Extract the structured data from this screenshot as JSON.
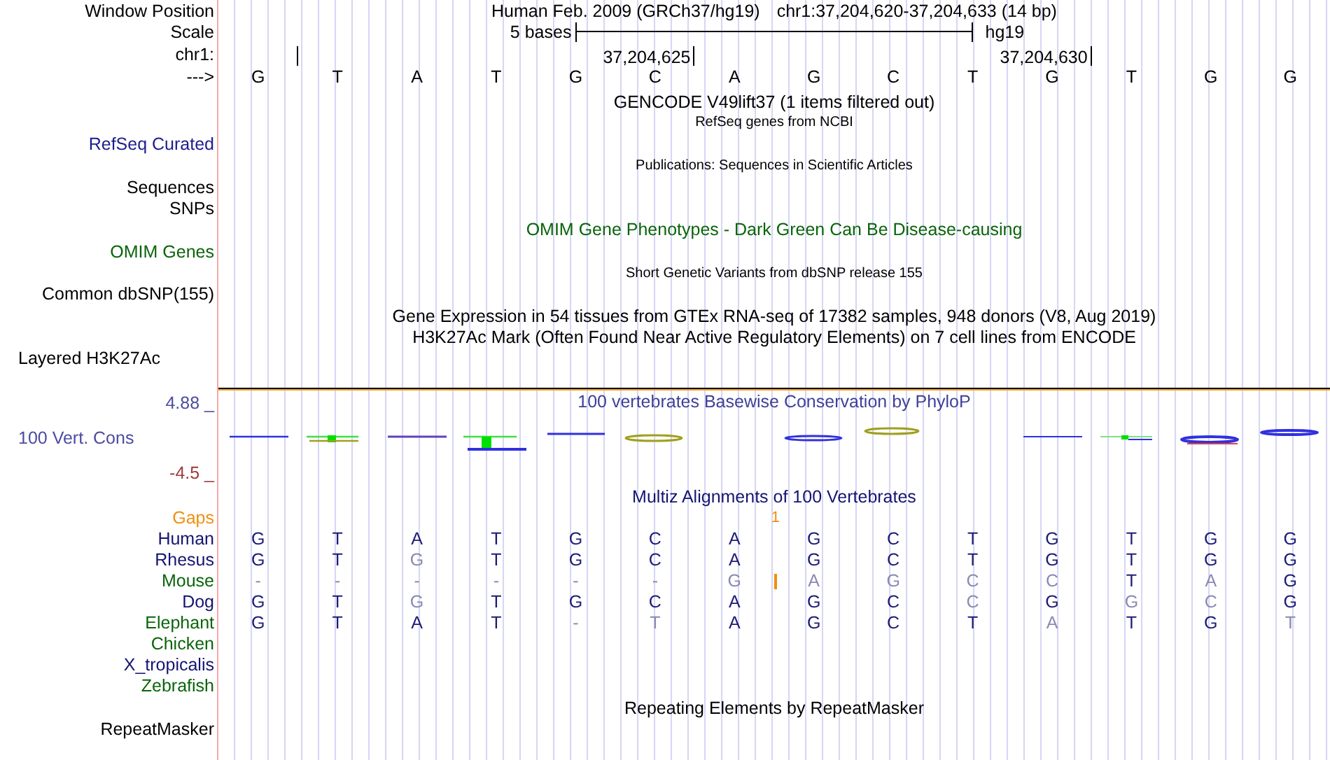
{
  "position_row": {
    "label": "Window Position",
    "assembly": "Human Feb. 2009 (GRCh37/hg19)",
    "range": "chr1:37,204,620-37,204,633 (14 bp)"
  },
  "scale_row": {
    "label": "Scale",
    "span": "5 bases",
    "tag": "hg19"
  },
  "ruler_row": {
    "label": "chr1:",
    "ticks": [
      {
        "kind": "plain"
      },
      {
        "kind": "labeled",
        "text": "37,204,625"
      },
      {
        "kind": "labeled",
        "text": "37,204,630"
      }
    ]
  },
  "sequence_row": {
    "label": "--->",
    "bases": [
      "G",
      "T",
      "A",
      "T",
      "G",
      "C",
      "A",
      "G",
      "C",
      "T",
      "G",
      "T",
      "G",
      "G"
    ]
  },
  "track_lines": [
    {
      "kind": "title",
      "text": "GENCODE V49lift37 (1 items filtered out)",
      "color": "#000000"
    },
    {
      "kind": "note",
      "text": "RefSeq genes from NCBI",
      "color": "#000000"
    },
    {
      "kind": "label",
      "text": "RefSeq Curated",
      "color": "#1c1c90"
    },
    {
      "kind": "note",
      "text": "Publications: Sequences in Scientific Articles",
      "color": "#000000"
    },
    {
      "kind": "label",
      "text": "Sequences",
      "color": "#000000"
    },
    {
      "kind": "label",
      "text": "SNPs",
      "color": "#000000"
    },
    {
      "kind": "title",
      "text": "OMIM Gene Phenotypes - Dark Green Can Be Disease-causing",
      "color": "#0a640a"
    },
    {
      "kind": "label",
      "text": "OMIM Genes",
      "color": "#0a640a"
    },
    {
      "kind": "note",
      "text": "Short Genetic Variants from dbSNP release 155",
      "color": "#000000"
    },
    {
      "kind": "label",
      "text": "Common dbSNP(155)",
      "color": "#000000"
    },
    {
      "kind": "title",
      "text": "Gene Expression in 54 tissues from GTEx RNA-seq of 17382 samples, 948 donors (V8, Aug 2019)",
      "color": "#000000"
    },
    {
      "kind": "title",
      "text": "H3K27Ac Mark (Often Found Near Active Regulatory Elements) on 7 cell lines from ENCODE",
      "color": "#000000"
    },
    {
      "kind": "side_label",
      "text": "Layered H3K27Ac",
      "color": "#000000"
    }
  ],
  "conservation": {
    "title": "100 vertebrates Basewise Conservation by PhyloP",
    "label": "100 Vert. Cons",
    "max": "4.88 _",
    "min": "-4.5 _"
  },
  "multiz": {
    "title": "Multiz Alignments of 100 Vertebrates",
    "gaps_label": "Gaps",
    "species": [
      {
        "name": "Human",
        "color": "#141470",
        "bases": [
          {
            "text": "G",
            "match": true
          },
          {
            "text": "T",
            "match": true
          },
          {
            "text": "A",
            "match": true
          },
          {
            "text": "T",
            "match": true
          },
          {
            "text": "G",
            "match": true
          },
          {
            "text": "C",
            "match": true
          },
          {
            "text": "A",
            "match": true
          },
          {
            "text": "G",
            "match": true
          },
          {
            "text": "C",
            "match": true
          },
          {
            "text": "T",
            "match": true
          },
          {
            "text": "G",
            "match": true
          },
          {
            "text": "T",
            "match": true
          },
          {
            "text": "G",
            "match": true
          },
          {
            "text": "G",
            "match": true
          }
        ]
      },
      {
        "name": "Rhesus",
        "color": "#141470",
        "bases": [
          {
            "text": "G",
            "match": true
          },
          {
            "text": "T",
            "match": true
          },
          {
            "text": "G",
            "match": false
          },
          {
            "text": "T",
            "match": true
          },
          {
            "text": "G",
            "match": true
          },
          {
            "text": "C",
            "match": true
          },
          {
            "text": "A",
            "match": true
          },
          {
            "text": "G",
            "match": true
          },
          {
            "text": "C",
            "match": true
          },
          {
            "text": "T",
            "match": true
          },
          {
            "text": "G",
            "match": true
          },
          {
            "text": "T",
            "match": true
          },
          {
            "text": "G",
            "match": true
          },
          {
            "text": "G",
            "match": true
          }
        ]
      },
      {
        "name": "Mouse",
        "color": "#0a640a",
        "bases": [
          {
            "text": "-",
            "match": false
          },
          {
            "text": "-",
            "match": false
          },
          {
            "text": "-",
            "match": false
          },
          {
            "text": "-",
            "match": false
          },
          {
            "text": "-",
            "match": false
          },
          {
            "text": "-",
            "match": false
          },
          {
            "text": "G",
            "match": false,
            "insertion": "1"
          },
          {
            "text": "A",
            "match": false
          },
          {
            "text": "G",
            "match": false
          },
          {
            "text": "C",
            "match": false
          },
          {
            "text": "C",
            "match": false
          },
          {
            "text": "T",
            "match": true
          },
          {
            "text": "A",
            "match": false
          },
          {
            "text": "G",
            "match": true
          }
        ]
      },
      {
        "name": "Dog",
        "color": "#141470",
        "bases": [
          {
            "text": "G",
            "match": true
          },
          {
            "text": "T",
            "match": true
          },
          {
            "text": "G",
            "match": false
          },
          {
            "text": "T",
            "match": true
          },
          {
            "text": "G",
            "match": true
          },
          {
            "text": "C",
            "match": true
          },
          {
            "text": "A",
            "match": true
          },
          {
            "text": "G",
            "match": true
          },
          {
            "text": "C",
            "match": true
          },
          {
            "text": "C",
            "match": false
          },
          {
            "text": "G",
            "match": true
          },
          {
            "text": "G",
            "match": false
          },
          {
            "text": "C",
            "match": false
          },
          {
            "text": "G",
            "match": true
          }
        ]
      },
      {
        "name": "Elephant",
        "color": "#0a640a",
        "bases": [
          {
            "text": "G",
            "match": true
          },
          {
            "text": "T",
            "match": true
          },
          {
            "text": "A",
            "match": true
          },
          {
            "text": "T",
            "match": true
          },
          {
            "text": "-",
            "match": false
          },
          {
            "text": "T",
            "match": false
          },
          {
            "text": "A",
            "match": true
          },
          {
            "text": "G",
            "match": true
          },
          {
            "text": "C",
            "match": true
          },
          {
            "text": "T",
            "match": true
          },
          {
            "text": "A",
            "match": false
          },
          {
            "text": "T",
            "match": true
          },
          {
            "text": "G",
            "match": true
          },
          {
            "text": "T",
            "match": false
          }
        ]
      },
      {
        "name": "Chicken",
        "color": "#0a640a"
      },
      {
        "name": "X_tropicalis",
        "color": "#141470"
      },
      {
        "name": "Zebrafish",
        "color": "#0a640a"
      }
    ]
  },
  "repeats": {
    "title": "Repeating Elements by RepeatMasker",
    "label": "RepeatMasker"
  }
}
